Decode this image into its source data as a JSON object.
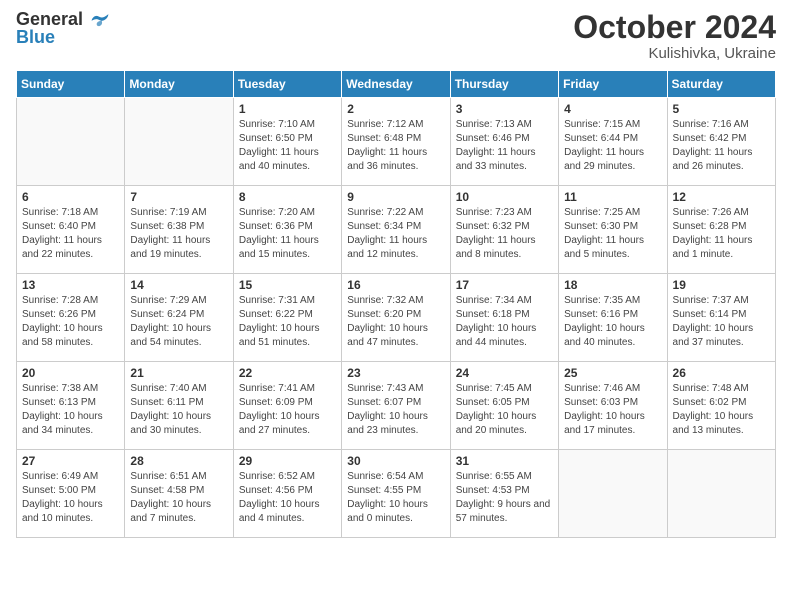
{
  "header": {
    "logo_general": "General",
    "logo_blue": "Blue",
    "month": "October 2024",
    "location": "Kulishivka, Ukraine"
  },
  "weekdays": [
    "Sunday",
    "Monday",
    "Tuesday",
    "Wednesday",
    "Thursday",
    "Friday",
    "Saturday"
  ],
  "weeks": [
    [
      {
        "day": "",
        "info": ""
      },
      {
        "day": "",
        "info": ""
      },
      {
        "day": "1",
        "info": "Sunrise: 7:10 AM\nSunset: 6:50 PM\nDaylight: 11 hours and 40 minutes."
      },
      {
        "day": "2",
        "info": "Sunrise: 7:12 AM\nSunset: 6:48 PM\nDaylight: 11 hours and 36 minutes."
      },
      {
        "day": "3",
        "info": "Sunrise: 7:13 AM\nSunset: 6:46 PM\nDaylight: 11 hours and 33 minutes."
      },
      {
        "day": "4",
        "info": "Sunrise: 7:15 AM\nSunset: 6:44 PM\nDaylight: 11 hours and 29 minutes."
      },
      {
        "day": "5",
        "info": "Sunrise: 7:16 AM\nSunset: 6:42 PM\nDaylight: 11 hours and 26 minutes."
      }
    ],
    [
      {
        "day": "6",
        "info": "Sunrise: 7:18 AM\nSunset: 6:40 PM\nDaylight: 11 hours and 22 minutes."
      },
      {
        "day": "7",
        "info": "Sunrise: 7:19 AM\nSunset: 6:38 PM\nDaylight: 11 hours and 19 minutes."
      },
      {
        "day": "8",
        "info": "Sunrise: 7:20 AM\nSunset: 6:36 PM\nDaylight: 11 hours and 15 minutes."
      },
      {
        "day": "9",
        "info": "Sunrise: 7:22 AM\nSunset: 6:34 PM\nDaylight: 11 hours and 12 minutes."
      },
      {
        "day": "10",
        "info": "Sunrise: 7:23 AM\nSunset: 6:32 PM\nDaylight: 11 hours and 8 minutes."
      },
      {
        "day": "11",
        "info": "Sunrise: 7:25 AM\nSunset: 6:30 PM\nDaylight: 11 hours and 5 minutes."
      },
      {
        "day": "12",
        "info": "Sunrise: 7:26 AM\nSunset: 6:28 PM\nDaylight: 11 hours and 1 minute."
      }
    ],
    [
      {
        "day": "13",
        "info": "Sunrise: 7:28 AM\nSunset: 6:26 PM\nDaylight: 10 hours and 58 minutes."
      },
      {
        "day": "14",
        "info": "Sunrise: 7:29 AM\nSunset: 6:24 PM\nDaylight: 10 hours and 54 minutes."
      },
      {
        "day": "15",
        "info": "Sunrise: 7:31 AM\nSunset: 6:22 PM\nDaylight: 10 hours and 51 minutes."
      },
      {
        "day": "16",
        "info": "Sunrise: 7:32 AM\nSunset: 6:20 PM\nDaylight: 10 hours and 47 minutes."
      },
      {
        "day": "17",
        "info": "Sunrise: 7:34 AM\nSunset: 6:18 PM\nDaylight: 10 hours and 44 minutes."
      },
      {
        "day": "18",
        "info": "Sunrise: 7:35 AM\nSunset: 6:16 PM\nDaylight: 10 hours and 40 minutes."
      },
      {
        "day": "19",
        "info": "Sunrise: 7:37 AM\nSunset: 6:14 PM\nDaylight: 10 hours and 37 minutes."
      }
    ],
    [
      {
        "day": "20",
        "info": "Sunrise: 7:38 AM\nSunset: 6:13 PM\nDaylight: 10 hours and 34 minutes."
      },
      {
        "day": "21",
        "info": "Sunrise: 7:40 AM\nSunset: 6:11 PM\nDaylight: 10 hours and 30 minutes."
      },
      {
        "day": "22",
        "info": "Sunrise: 7:41 AM\nSunset: 6:09 PM\nDaylight: 10 hours and 27 minutes."
      },
      {
        "day": "23",
        "info": "Sunrise: 7:43 AM\nSunset: 6:07 PM\nDaylight: 10 hours and 23 minutes."
      },
      {
        "day": "24",
        "info": "Sunrise: 7:45 AM\nSunset: 6:05 PM\nDaylight: 10 hours and 20 minutes."
      },
      {
        "day": "25",
        "info": "Sunrise: 7:46 AM\nSunset: 6:03 PM\nDaylight: 10 hours and 17 minutes."
      },
      {
        "day": "26",
        "info": "Sunrise: 7:48 AM\nSunset: 6:02 PM\nDaylight: 10 hours and 13 minutes."
      }
    ],
    [
      {
        "day": "27",
        "info": "Sunrise: 6:49 AM\nSunset: 5:00 PM\nDaylight: 10 hours and 10 minutes."
      },
      {
        "day": "28",
        "info": "Sunrise: 6:51 AM\nSunset: 4:58 PM\nDaylight: 10 hours and 7 minutes."
      },
      {
        "day": "29",
        "info": "Sunrise: 6:52 AM\nSunset: 4:56 PM\nDaylight: 10 hours and 4 minutes."
      },
      {
        "day": "30",
        "info": "Sunrise: 6:54 AM\nSunset: 4:55 PM\nDaylight: 10 hours and 0 minutes."
      },
      {
        "day": "31",
        "info": "Sunrise: 6:55 AM\nSunset: 4:53 PM\nDaylight: 9 hours and 57 minutes."
      },
      {
        "day": "",
        "info": ""
      },
      {
        "day": "",
        "info": ""
      }
    ]
  ]
}
